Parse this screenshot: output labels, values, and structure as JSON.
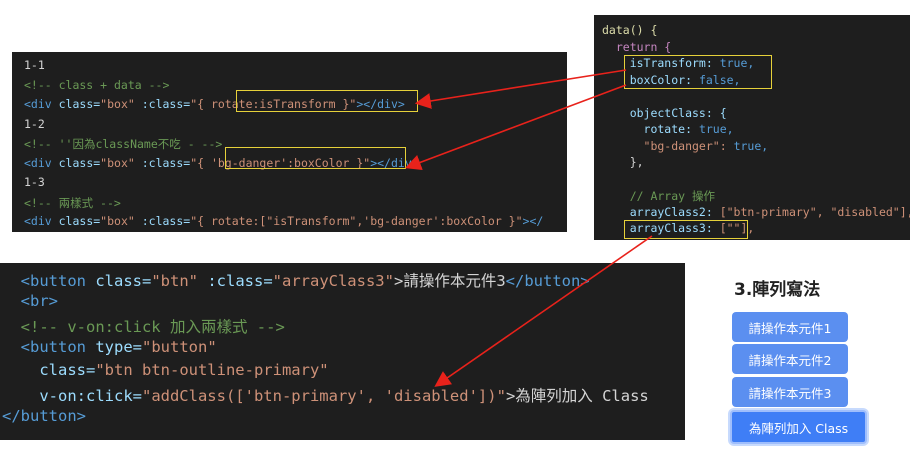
{
  "snippet1": {
    "lines": [
      [
        {
          "t": "1-1",
          "c": "num"
        }
      ],
      [
        {
          "t": "<!-- class + data -->",
          "c": "cmt"
        }
      ],
      [
        {
          "t": "<div ",
          "c": "tag"
        },
        {
          "t": "class=",
          "c": "attr"
        },
        {
          "t": "\"box\" ",
          "c": "str"
        },
        {
          "t": ":class=",
          "c": "attr"
        },
        {
          "t": "\"{ rotate:isTransform }\"",
          "c": "str"
        },
        {
          "t": "></div>",
          "c": "tag"
        }
      ],
      [
        {
          "t": "1-2",
          "c": "num"
        }
      ],
      [
        {
          "t": "<!-- ''因為className不吃 - -->",
          "c": "cmt"
        }
      ],
      [
        {
          "t": "<div ",
          "c": "tag"
        },
        {
          "t": "class=",
          "c": "attr"
        },
        {
          "t": "\"box\" ",
          "c": "str"
        },
        {
          "t": ":class=",
          "c": "attr"
        },
        {
          "t": "\"{ 'bg-danger':boxColor }\"",
          "c": "str"
        },
        {
          "t": "></div>",
          "c": "tag"
        }
      ],
      [
        {
          "t": "1-3",
          "c": "num"
        }
      ],
      [
        {
          "t": "<!-- 兩樣式 -->",
          "c": "cmt"
        }
      ],
      [
        {
          "t": "<div ",
          "c": "tag"
        },
        {
          "t": "class=",
          "c": "attr"
        },
        {
          "t": "\"box\" ",
          "c": "str"
        },
        {
          "t": ":class=",
          "c": "attr"
        },
        {
          "t": "\"{ rotate:[\"isTransform\",'bg-danger':boxColor }\"",
          "c": "str"
        },
        {
          "t": "></",
          "c": "tag"
        }
      ]
    ]
  },
  "snippet2": {
    "lines": [
      [
        {
          "t": "data() {",
          "c": "fn"
        }
      ],
      [
        {
          "t": "  return {",
          "c": "kw"
        }
      ],
      [
        {
          "t": "    isTransform: ",
          "c": "prop"
        },
        {
          "t": "true,",
          "c": "bool"
        }
      ],
      [
        {
          "t": "    boxColor: ",
          "c": "prop"
        },
        {
          "t": "false,",
          "c": "bool"
        }
      ],
      [
        {
          "t": "",
          "c": "txt"
        }
      ],
      [
        {
          "t": "    objectClass: {",
          "c": "prop"
        }
      ],
      [
        {
          "t": "      rotate: ",
          "c": "prop"
        },
        {
          "t": "true,",
          "c": "bool"
        }
      ],
      [
        {
          "t": "      \"bg-danger\": ",
          "c": "str"
        },
        {
          "t": "true,",
          "c": "bool"
        }
      ],
      [
        {
          "t": "    },",
          "c": "txt"
        }
      ],
      [
        {
          "t": "",
          "c": "txt"
        }
      ],
      [
        {
          "t": "    // Array 操作",
          "c": "cmt"
        }
      ],
      [
        {
          "t": "    arrayClass2: ",
          "c": "prop"
        },
        {
          "t": "[\"btn-primary\", \"disabled\"],",
          "c": "str"
        }
      ],
      [
        {
          "t": "    arrayClass3: ",
          "c": "prop"
        },
        {
          "t": "[\"\"],",
          "c": "str"
        }
      ]
    ]
  },
  "snippet3": {
    "lines": [
      [
        {
          "t": "  <button ",
          "c": "tag"
        },
        {
          "t": "class=",
          "c": "attr"
        },
        {
          "t": "\"btn\" ",
          "c": "str"
        },
        {
          "t": ":class=",
          "c": "attr"
        },
        {
          "t": "\"arrayClass3\"",
          "c": "str"
        },
        {
          "t": ">請操作本元件3",
          "c": "txt"
        },
        {
          "t": "</button>",
          "c": "tag"
        }
      ],
      [
        {
          "t": "  <br>",
          "c": "tag"
        }
      ],
      [
        {
          "t": "  <!-- v-on:click 加入兩樣式 -->",
          "c": "cmt"
        }
      ],
      [
        {
          "t": "  <button ",
          "c": "tag"
        },
        {
          "t": "type=",
          "c": "attr"
        },
        {
          "t": "\"button\"",
          "c": "str"
        }
      ],
      [
        {
          "t": "    class=",
          "c": "attr"
        },
        {
          "t": "\"btn btn-outline-primary\"",
          "c": "str"
        }
      ],
      [
        {
          "t": "    v-on:click=",
          "c": "attr"
        },
        {
          "t": "\"addClass(['btn-primary', 'disabled'])\"",
          "c": "str"
        },
        {
          "t": ">為陣列加入 Class",
          "c": "txt"
        }
      ],
      [
        {
          "t": "</button>",
          "c": "tag"
        }
      ]
    ]
  },
  "demo": {
    "title": "3.陣列寫法",
    "buttons": [
      "請操作本元件1",
      "請操作本元件2",
      "請操作本元件3",
      "為陣列加入 Class"
    ]
  },
  "colors": {
    "arrow": "#e8221b",
    "highlight_box": "#e6d13a",
    "button_blue": "#5b8ff0",
    "button_primary": "#3f7ef6"
  }
}
